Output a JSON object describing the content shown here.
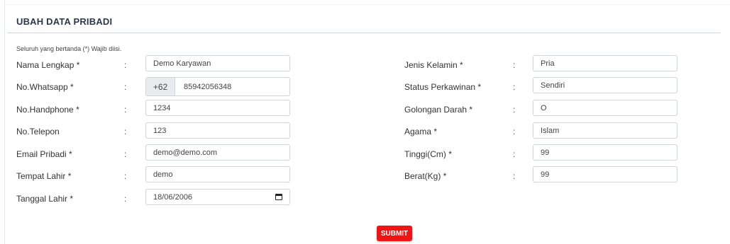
{
  "form": {
    "title": "UBAH DATA PRIBADI",
    "required_note": "Seluruh yang bertanda (*) Wajib diisi.",
    "colon": ":",
    "left_fields": [
      {
        "label": "Nama Lengkap *",
        "value": "Demo Karyawan"
      },
      {
        "label": "No.Whatsapp *",
        "prefix": "+62",
        "value": "85942056348"
      },
      {
        "label": "No.Handphone *",
        "value": "1234"
      },
      {
        "label": "No.Telepon",
        "value": "123"
      },
      {
        "label": "Email Pribadi *",
        "value": "demo@demo.com"
      },
      {
        "label": "Tempat Lahir *",
        "value": "demo"
      },
      {
        "label": "Tanggal Lahir *",
        "value": "18/06/2006",
        "icon": "calendar-icon"
      }
    ],
    "right_fields": [
      {
        "label": "Jenis Kelamin *",
        "value": "Pria"
      },
      {
        "label": "Status Perkawinan *",
        "value": "Sendiri"
      },
      {
        "label": "Golongan Darah *",
        "value": "O"
      },
      {
        "label": "Agama *",
        "value": "Islam"
      },
      {
        "label": "Tinggi(Cm) *",
        "value": "99"
      },
      {
        "label": "Berat(Kg) *",
        "value": "99"
      }
    ],
    "submit_label": "SUBMIT",
    "colors": {
      "submit": "#f01414",
      "addon_bg": "#e9ecef",
      "border": "#ced4da"
    }
  }
}
